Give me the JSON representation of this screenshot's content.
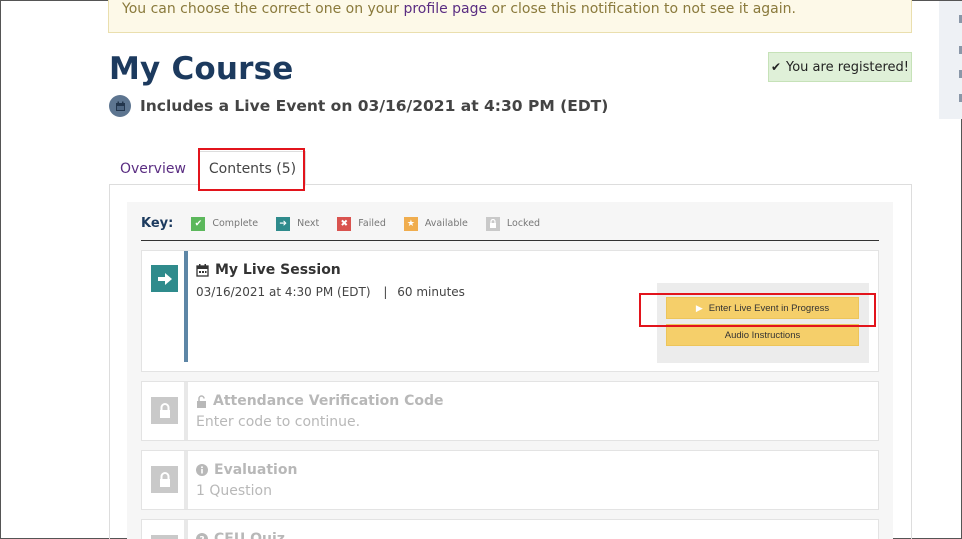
{
  "notice": {
    "text_before": "You can choose the correct one on your ",
    "link": "profile page",
    "text_after": " or close this notification to not see it again."
  },
  "page": {
    "title": "My Course",
    "event_line": "Includes a Live Event on 03/16/2021 at 4:30 PM (EDT)"
  },
  "status_badge": {
    "text": "You are registered!",
    "color": "#dff0d8"
  },
  "tabs": [
    {
      "label": "Overview",
      "active": false
    },
    {
      "label": "Contents (5)",
      "active": true
    }
  ],
  "key": {
    "title": "Key:",
    "items": [
      {
        "label": "Complete",
        "color": "#5cb85c",
        "icon": "check-icon"
      },
      {
        "label": "Next",
        "color": "#2f8b8c",
        "icon": "arrow-right-icon"
      },
      {
        "label": "Failed",
        "color": "#d9534f",
        "icon": "x-icon"
      },
      {
        "label": "Available",
        "color": "#f0ad4e",
        "icon": "star-icon"
      },
      {
        "label": "Locked",
        "color": "#c9c9c9",
        "icon": "lock-icon"
      }
    ]
  },
  "contents": {
    "live_session": {
      "title": "My Live Session",
      "date": "03/16/2021 at 4:30 PM (EDT)",
      "separator": "|",
      "duration": "60 minutes",
      "enter_button": "Enter Live Event in Progress",
      "audio_button": "Audio Instructions"
    },
    "attendance": {
      "title": "Attendance Verification Code",
      "subtitle": "Enter code to continue."
    },
    "evaluation": {
      "title": "Evaluation",
      "subtitle": "1 Question"
    },
    "ceu_quiz": {
      "title": "CEU Quiz"
    }
  },
  "colors": {
    "accent": "#1c3a5e",
    "highlight": "#e2141c",
    "button": "#f5cf6a"
  }
}
